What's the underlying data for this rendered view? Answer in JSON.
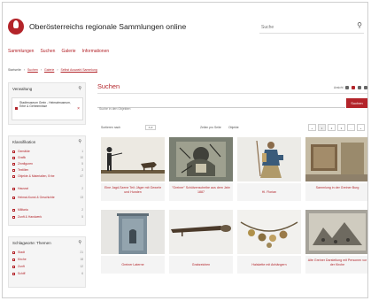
{
  "header": {
    "title": "Oberösterreichs regionale Sammlungen online",
    "search_placeholder": "Suche",
    "search_icon": "search-icon"
  },
  "nav": [
    "Sammlungen",
    "Suchen",
    "Galerie",
    "Informationen"
  ],
  "breadcrumb": [
    "Startseite",
    "Suchen",
    "Galerie",
    "Selbst Auswahl Sammlung"
  ],
  "sidebar": {
    "selection": {
      "title": "Verwaltung",
      "tag": "Stadtmuseum Grein - Heimatmuseum, Erbe & Geheimnisse"
    },
    "classification": {
      "title": "Klassifikation",
      "items": [
        {
          "label": "Gemälde",
          "count": "1"
        },
        {
          "label": "Grafik",
          "count": "10"
        },
        {
          "label": "Zinnfiguren",
          "count": "5"
        },
        {
          "label": "Textilien",
          "count": "3"
        },
        {
          "label": "Objekte & Materialien, Erbe",
          "count": "47"
        },
        {
          "label": "Hausrat",
          "count": "2"
        },
        {
          "label": "Heimat-Kunst & Geschichte",
          "count": "13"
        },
        {
          "label": "Militaria",
          "count": "2"
        },
        {
          "label": "Zunft & Handwerk",
          "count": "5"
        }
      ]
    },
    "themes": {
      "title": "Schlagworte: Themen",
      "items": [
        {
          "label": "Stadt",
          "count": "21"
        },
        {
          "label": "Kirche",
          "count": "18"
        },
        {
          "label": "Zunft",
          "count": "12"
        },
        {
          "label": "Schiff",
          "count": "6"
        }
      ]
    }
  },
  "main": {
    "title": "Suchen",
    "view_label": "Ansicht",
    "search_placeholder": "Suche in den Objekten",
    "search_button": "Suchen",
    "sort_label": "Sortieren nach",
    "sort_value": "A-Z",
    "per_page": "Zeilen pro Seite",
    "result_label": "Objekte",
    "pages": [
      "«",
      "1",
      "2",
      "3",
      "...",
      "»"
    ]
  },
  "tiles": [
    {
      "caption": "Eine Jagd-Szene Teil: Jäger mit Gewehr und Hunden",
      "img": "hunt"
    },
    {
      "caption": "\"Greiner\" Schützenscheibe aus dem Jahr 1887",
      "img": "target"
    },
    {
      "caption": "Hl. Florian",
      "img": "saint"
    },
    {
      "caption": "Sammlung in der Greiner Burg",
      "img": "room"
    },
    {
      "caption": "Greiner Laterne",
      "img": "lantern"
    },
    {
      "caption": "Grabzeichen",
      "img": "tool"
    },
    {
      "caption": "Halskette mit Anhängern",
      "img": "chain"
    },
    {
      "caption": "Alte Greiner Darstellung mit Personen vor der Kirche",
      "img": "print"
    }
  ],
  "colors": {
    "accent": "#b3242a",
    "sidebar_bg": "#f5f5f5"
  }
}
